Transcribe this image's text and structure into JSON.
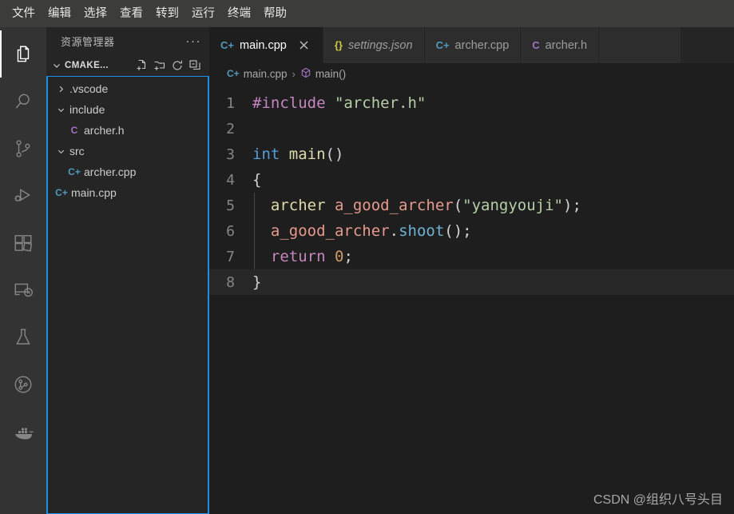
{
  "menubar": {
    "items": [
      {
        "label": "文件",
        "name": "menu-file"
      },
      {
        "label": "编辑",
        "name": "menu-edit"
      },
      {
        "label": "选择",
        "name": "menu-selection"
      },
      {
        "label": "查看",
        "name": "menu-view"
      },
      {
        "label": "转到",
        "name": "menu-go"
      },
      {
        "label": "运行",
        "name": "menu-run"
      },
      {
        "label": "终端",
        "name": "menu-terminal"
      },
      {
        "label": "帮助",
        "name": "menu-help"
      }
    ]
  },
  "activitybar": {
    "items": [
      {
        "icon": "files-explorer-icon",
        "active": true
      },
      {
        "icon": "search-icon",
        "active": false
      },
      {
        "icon": "source-control-icon",
        "active": false
      },
      {
        "icon": "run-and-debug-icon",
        "active": false
      },
      {
        "icon": "extensions-icon",
        "active": false
      },
      {
        "icon": "remote-explorer-icon",
        "active": false
      },
      {
        "icon": "testing-flask-icon",
        "active": false
      },
      {
        "icon": "gitlens-icon",
        "active": false
      },
      {
        "icon": "docker-whale-icon",
        "active": false
      }
    ]
  },
  "sidebar": {
    "title": "资源管理器",
    "more_actions": "···",
    "section": {
      "title": "CMAKE...",
      "actions": [
        "new-file-icon",
        "new-folder-icon",
        "refresh-icon",
        "collapse-all-icon"
      ]
    },
    "tree": [
      {
        "label": ".vscode",
        "kind": "folder",
        "expanded": false,
        "depth": 0,
        "icon": ""
      },
      {
        "label": "include",
        "kind": "folder",
        "expanded": true,
        "depth": 0,
        "icon": ""
      },
      {
        "label": "archer.h",
        "kind": "file",
        "depth": 1,
        "icon": "C",
        "icon_class": "ic-h"
      },
      {
        "label": "src",
        "kind": "folder",
        "expanded": true,
        "depth": 0,
        "icon": ""
      },
      {
        "label": "archer.cpp",
        "kind": "file",
        "depth": 1,
        "icon": "C+",
        "icon_class": "ic-cpp"
      },
      {
        "label": "main.cpp",
        "kind": "file",
        "depth": 0,
        "icon": "C+",
        "icon_class": "ic-cpp"
      }
    ]
  },
  "tabs": [
    {
      "label": "main.cpp",
      "icon": "C+",
      "icon_class": "cpp",
      "active": true,
      "preview": false,
      "closable": true
    },
    {
      "label": "settings.json",
      "icon": "{}",
      "icon_class": "json",
      "active": false,
      "preview": true,
      "closable": false
    },
    {
      "label": "archer.cpp",
      "icon": "C+",
      "icon_class": "cpp",
      "active": false,
      "preview": false,
      "closable": false
    },
    {
      "label": "archer.h",
      "icon": "C",
      "icon_class": "h",
      "active": false,
      "preview": false,
      "closable": false
    }
  ],
  "breadcrumbs": {
    "file": "main.cpp",
    "file_icon": "C+",
    "separator": "›",
    "symbol": "main()",
    "symbol_icon": "symbol-method-cube-icon"
  },
  "editor": {
    "lines": [
      {
        "n": "1",
        "current": false
      },
      {
        "n": "2",
        "current": false
      },
      {
        "n": "3",
        "current": false
      },
      {
        "n": "4",
        "current": false
      },
      {
        "n": "5",
        "current": false
      },
      {
        "n": "6",
        "current": false
      },
      {
        "n": "7",
        "current": false
      },
      {
        "n": "8",
        "current": true
      }
    ],
    "code": {
      "l1_include": "#include",
      "l1_header": "\"archer.h\"",
      "l3_int": "int",
      "l3_main": "main",
      "l3_parens": "()",
      "l4_brace": "{",
      "l5_type": "archer",
      "l5_var": "a_good_archer",
      "l5_open": "(",
      "l5_str": "\"yangyouji\"",
      "l5_close": ");",
      "l6_var": "a_good_archer",
      "l6_dot": ".",
      "l6_method": "shoot",
      "l6_close": "();",
      "l7_return": "return",
      "l7_num": "0",
      "l7_semi": ";",
      "l8_brace": "}"
    }
  },
  "watermark": "CSDN @组织八号头目",
  "colors": {
    "accent_focus_border": "#1b8fe6",
    "editor_bg": "#1e1e1e",
    "sidebar_bg": "#252526",
    "activitybar_bg": "#333333",
    "menubar_bg": "#3c3c3a",
    "tabbar_bg": "#2d2d2d",
    "cpp_icon": "#519aba",
    "header_icon": "#a074c4",
    "json_icon": "#cbcb41"
  }
}
